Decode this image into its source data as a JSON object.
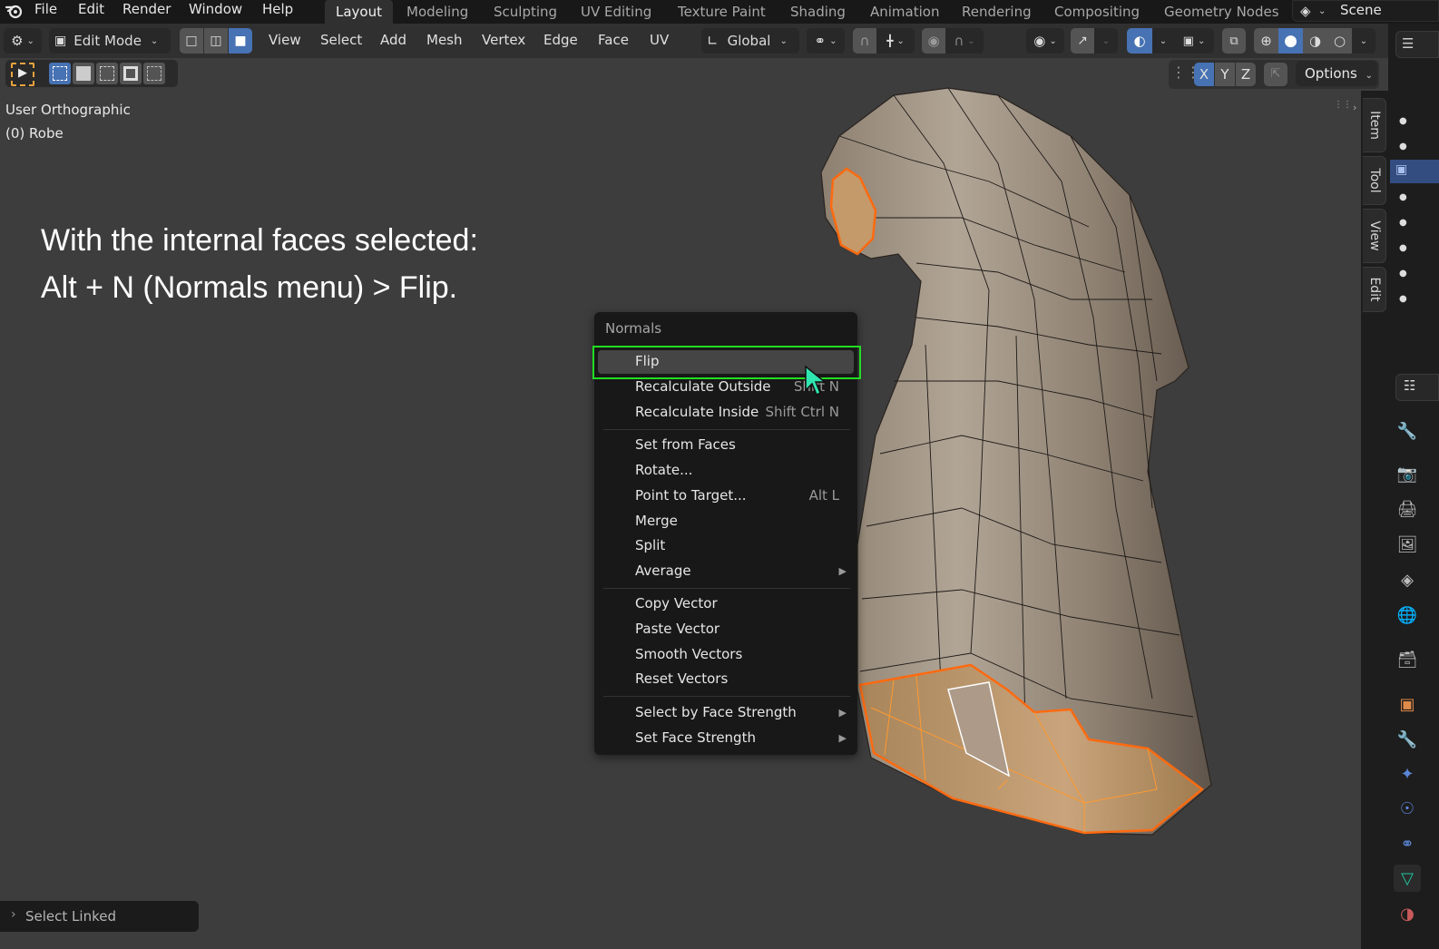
{
  "topbar": {
    "app_icon": "blender-logo-icon",
    "menus": [
      "File",
      "Edit",
      "Render",
      "Window",
      "Help"
    ],
    "workspaces": [
      {
        "label": "Layout",
        "active": true
      },
      {
        "label": "Modeling",
        "active": false
      },
      {
        "label": "Sculpting",
        "active": false
      },
      {
        "label": "UV Editing",
        "active": false
      },
      {
        "label": "Texture Paint",
        "active": false
      },
      {
        "label": "Shading",
        "active": false
      },
      {
        "label": "Animation",
        "active": false
      },
      {
        "label": "Rendering",
        "active": false
      },
      {
        "label": "Compositing",
        "active": false
      },
      {
        "label": "Geometry Nodes",
        "active": false
      }
    ],
    "scene_icon": "scene-icon",
    "scene_name": "Scene"
  },
  "header": {
    "editor_type_icon": "viewport-editor-icon",
    "mode": "Edit Mode",
    "select_modes": [
      {
        "name": "vertex-select-mode",
        "active": false
      },
      {
        "name": "edge-select-mode",
        "active": false
      },
      {
        "name": "face-select-mode",
        "active": true
      }
    ],
    "menus": [
      "View",
      "Select",
      "Add",
      "Mesh",
      "Vertex",
      "Edge",
      "Face",
      "UV"
    ],
    "transform_orientation": "Global",
    "pivot_icon": "pivot-point-icon",
    "snap_icon": "snap-magnet-icon",
    "snap_target_icon": "snap-increment-icon",
    "proportional_icon": "proportional-edit-icon",
    "falloff_icon": "falloff-curve-icon",
    "visibility_icon": "object-visibility-icon",
    "gizmo_icon": "gizmo-icon",
    "overlay_icon": "overlay-icon",
    "mesh_overlay_icon": "mesh-edit-overlay-icon",
    "xray_icon": "xray-icon",
    "shading_modes": [
      {
        "name": "wireframe",
        "active": false
      },
      {
        "name": "solid",
        "active": true
      },
      {
        "name": "material-preview",
        "active": false
      },
      {
        "name": "rendered",
        "active": false
      }
    ]
  },
  "toolrow": {
    "select_box_modes": [
      "set",
      "extend",
      "subtract",
      "difference",
      "intersect"
    ],
    "mirror_icon": "mirror-icon",
    "axes": [
      {
        "label": "X",
        "active": true
      },
      {
        "label": "Y",
        "active": false
      },
      {
        "label": "Z",
        "active": false
      }
    ],
    "options_label": "Options"
  },
  "viewport": {
    "view_name": "User Orthographic",
    "object_name": "(0) Robe",
    "caption_line1": "With the internal faces selected:",
    "caption_line2": "Alt + N (Normals menu) > Flip."
  },
  "normals_menu": {
    "title": "Normals",
    "groups": [
      [
        {
          "label": "Flip",
          "shortcut": "",
          "submenu": false,
          "highlighted": true
        },
        {
          "label": "Recalculate Outside",
          "shortcut": "Shift N",
          "submenu": false
        },
        {
          "label": "Recalculate Inside",
          "shortcut": "Shift Ctrl N",
          "submenu": false
        }
      ],
      [
        {
          "label": "Set from Faces",
          "shortcut": "",
          "submenu": false
        },
        {
          "label": "Rotate...",
          "shortcut": "",
          "submenu": false
        },
        {
          "label": "Point to Target...",
          "shortcut": "Alt L",
          "submenu": false
        },
        {
          "label": "Merge",
          "shortcut": "",
          "submenu": false
        },
        {
          "label": "Split",
          "shortcut": "",
          "submenu": false
        },
        {
          "label": "Average",
          "shortcut": "",
          "submenu": true
        }
      ],
      [
        {
          "label": "Copy Vector",
          "shortcut": "",
          "submenu": false
        },
        {
          "label": "Paste Vector",
          "shortcut": "",
          "submenu": false
        },
        {
          "label": "Smooth Vectors",
          "shortcut": "",
          "submenu": false
        },
        {
          "label": "Reset Vectors",
          "shortcut": "",
          "submenu": false
        }
      ],
      [
        {
          "label": "Select by Face Strength",
          "shortcut": "",
          "submenu": true
        },
        {
          "label": "Set Face Strength",
          "shortcut": "",
          "submenu": true
        }
      ]
    ]
  },
  "sidebar_tabs": [
    "Item",
    "Tool",
    "View",
    "Edit"
  ],
  "properties_icons": [
    {
      "name": "tool-icon",
      "color": "#bdbdbd"
    },
    {
      "name": "render-icon",
      "color": "#bdbdbd"
    },
    {
      "name": "output-icon",
      "color": "#bdbdbd"
    },
    {
      "name": "view-layer-icon",
      "color": "#bdbdbd"
    },
    {
      "name": "scene-icon",
      "color": "#bdbdbd"
    },
    {
      "name": "world-icon",
      "color": "#c85a5a"
    },
    {
      "name": "collection-icon",
      "color": "#bdbdbd"
    },
    {
      "name": "object-icon",
      "color": "#e08a4a"
    },
    {
      "name": "modifier-icon",
      "color": "#5b86d6"
    },
    {
      "name": "particles-icon",
      "color": "#5b86d6"
    },
    {
      "name": "physics-icon",
      "color": "#5b86d6"
    },
    {
      "name": "constraints-icon",
      "color": "#5b86d6"
    },
    {
      "name": "mesh-data-icon",
      "color": "#1ec8a0"
    },
    {
      "name": "material-icon",
      "color": "#c85a5a"
    }
  ],
  "operator_panel": {
    "label": "Select Linked"
  },
  "colors": {
    "accent": "#4772b3",
    "selection_orange": "#ff7a1a",
    "highlight_green": "#22dd22"
  }
}
